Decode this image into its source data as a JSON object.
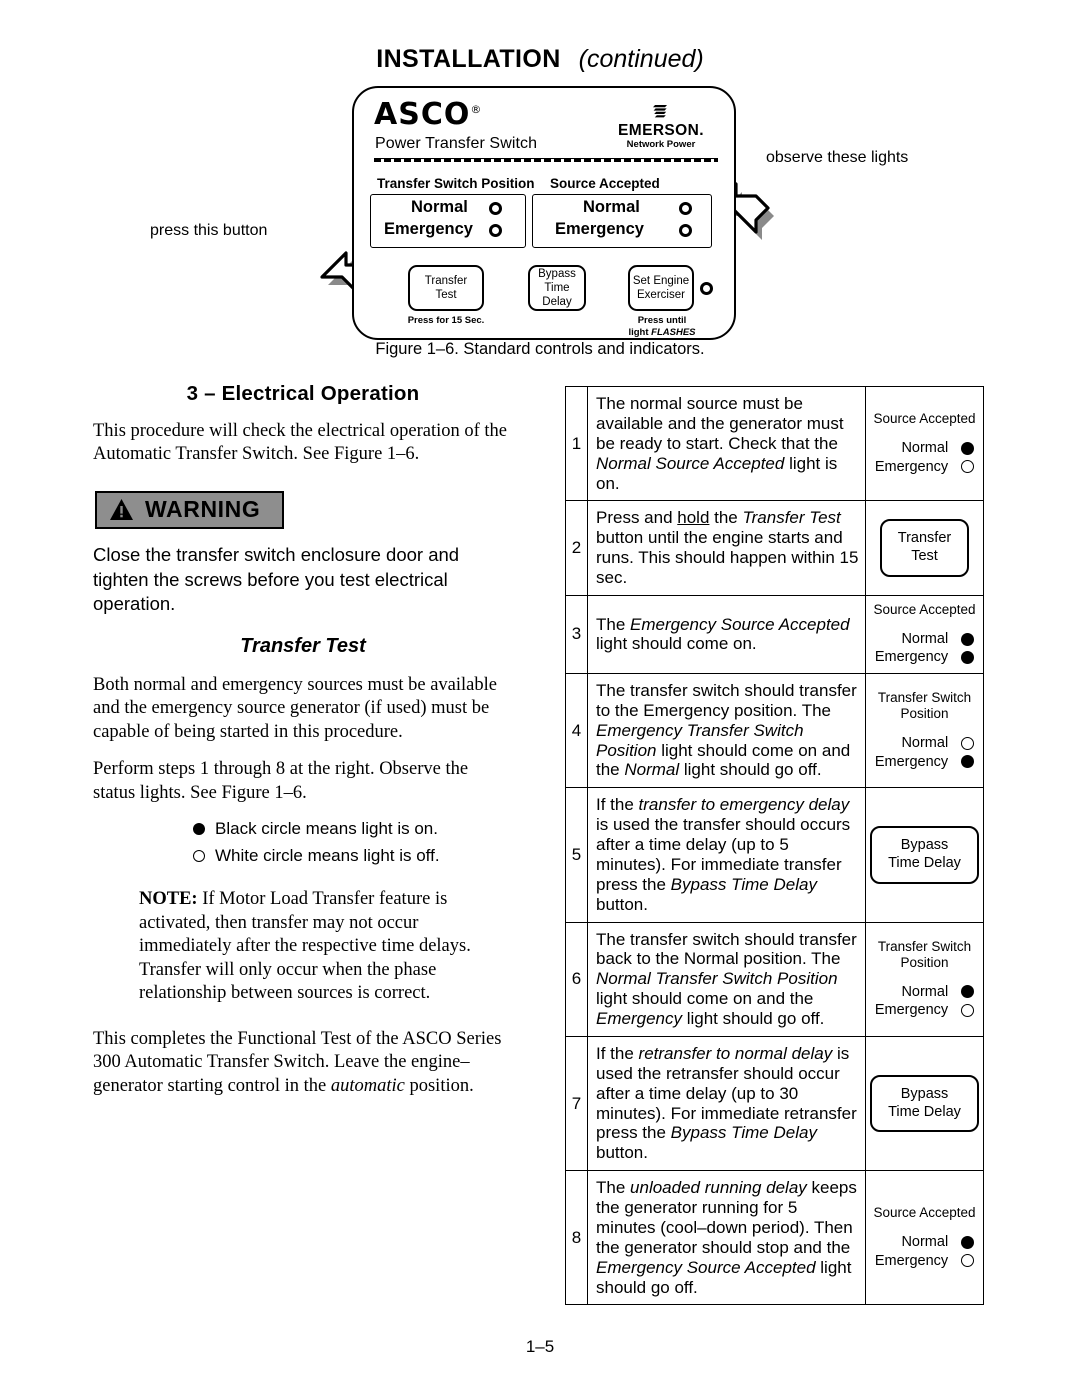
{
  "header": {
    "title": "INSTALLATION",
    "continued": "(continued)"
  },
  "figure": {
    "caption": "Figure 1–6.  Standard controls and indicators.",
    "callout_left": "press this button",
    "callout_right": "observe these lights",
    "panel": {
      "brand": "ASCO",
      "brand_mark": "®",
      "brand_sub": "Power Transfer Switch",
      "oem_name": "EMERSON.",
      "oem_sub": "Network Power",
      "group_left_label": "Transfer Switch Position",
      "group_right_label": "Source Accepted",
      "row_normal": "Normal",
      "row_emergency": "Emergency",
      "buttons": [
        {
          "line1": "Transfer",
          "line2": "Test",
          "note": "Press for 15 Sec.",
          "has_led": false
        },
        {
          "line1": "Bypass",
          "line2": "Time Delay",
          "note": "",
          "has_led": false
        },
        {
          "line1": "Set Engine",
          "line2": "Exerciser",
          "note_line1": "Press until",
          "note_line2a": "light ",
          "note_line2b": "FLASHES",
          "has_led": true
        }
      ]
    }
  },
  "left": {
    "section_heading": "3 – Electrical Operation",
    "intro": "This procedure will check the electrical operation of the Automatic Transfer Switch.  See Figure 1–6.",
    "warning_label": "WARNING",
    "warning_text": "Close the transfer switch enclosure door and tighten the screws before you test electrical operation.",
    "subheading": "Transfer Test",
    "para_sources": "Both normal and emergency sources must be available and the emergency source generator (if used) must be capable of being started in this procedure.",
    "para_perform": "Perform steps 1 through 8 at the right.  Observe the status lights.  See Figure 1–6.",
    "legend_on": "Black circle means light is on.",
    "legend_off": "White circle means light is off.",
    "note_label": "NOTE:",
    "note_text": "If Motor Load Transfer feature is activated, then transfer may not occur immediately after the respective time delays.  Transfer will only occur when the phase relationship between sources is correct.",
    "closing_a": "This completes the Functional Test of the ASCO Series 300 Automatic Transfer Switch.  Leave the engine–generator starting control in the ",
    "closing_italic": "automatic",
    "closing_b": " position."
  },
  "steps": [
    {
      "num": "1",
      "desc_parts": [
        {
          "t": "The normal source must be available and the generator must be ready to start. Check that the ",
          "s": "plain"
        },
        {
          "t": "Normal Source Accepted",
          "s": "italic"
        },
        {
          "t": " light is on.",
          "s": "plain"
        }
      ],
      "indicator": {
        "kind": "lights",
        "title": "Source Accepted",
        "normal": "Normal",
        "emergency": "Emergency",
        "normal_on": true,
        "emergency_on": false
      }
    },
    {
      "num": "2",
      "desc_parts": [
        {
          "t": "Press and ",
          "s": "plain"
        },
        {
          "t": "hold",
          "s": "underline"
        },
        {
          "t": " the ",
          "s": "plain"
        },
        {
          "t": "Transfer Test",
          "s": "italic"
        },
        {
          "t": " button until the engine starts and runs. This should happen within 15 sec.",
          "s": "plain"
        }
      ],
      "indicator": {
        "kind": "button",
        "line1": "Transfer",
        "line2": "Test"
      }
    },
    {
      "num": "3",
      "desc_parts": [
        {
          "t": "The ",
          "s": "plain"
        },
        {
          "t": "Emergency Source Accepted",
          "s": "italic"
        },
        {
          "t": " light should come on.",
          "s": "plain"
        }
      ],
      "indicator": {
        "kind": "lights",
        "title": "Source Accepted",
        "normal": "Normal",
        "emergency": "Emergency",
        "normal_on": true,
        "emergency_on": true
      }
    },
    {
      "num": "4",
      "desc_parts": [
        {
          "t": "The transfer switch should transfer to the Emergency position. The ",
          "s": "plain"
        },
        {
          "t": "Emergency Transfer Switch Position",
          "s": "italic"
        },
        {
          "t": " light should come on and the ",
          "s": "plain"
        },
        {
          "t": "Normal",
          "s": "italic"
        },
        {
          "t": " light should go off.",
          "s": "plain"
        }
      ],
      "indicator": {
        "kind": "lights",
        "title": "Transfer Switch Position",
        "normal": "Normal",
        "emergency": "Emergency",
        "normal_on": false,
        "emergency_on": true
      }
    },
    {
      "num": "5",
      "desc_parts": [
        {
          "t": "If the ",
          "s": "plain"
        },
        {
          "t": "transfer to emergency delay",
          "s": "italic"
        },
        {
          "t": " is used the transfer should occurs after a time delay (up to 5 minutes). For immediate transfer press the ",
          "s": "plain"
        },
        {
          "t": "Bypass Time Delay",
          "s": "italic"
        },
        {
          "t": " button.",
          "s": "plain"
        }
      ],
      "indicator": {
        "kind": "button",
        "line1": "Bypass",
        "line2": "Time Delay"
      }
    },
    {
      "num": "6",
      "desc_parts": [
        {
          "t": "The transfer switch should transfer back to the Normal position. The ",
          "s": "plain"
        },
        {
          "t": "Normal Transfer Switch Position",
          "s": "italic"
        },
        {
          "t": " light should come on and the ",
          "s": "plain"
        },
        {
          "t": "Emergency",
          "s": "italic"
        },
        {
          "t": " light should go off.",
          "s": "plain"
        }
      ],
      "indicator": {
        "kind": "lights",
        "title": "Transfer Switch Position",
        "normal": "Normal",
        "emergency": "Emergency",
        "normal_on": true,
        "emergency_on": false
      }
    },
    {
      "num": "7",
      "desc_parts": [
        {
          "t": "If the ",
          "s": "plain"
        },
        {
          "t": "retransfer to normal delay",
          "s": "italic"
        },
        {
          "t": " is used the retransfer should occur after a time delay (up to 30 minutes). For immediate retransfer press the ",
          "s": "plain"
        },
        {
          "t": "Bypass Time Delay",
          "s": "italic"
        },
        {
          "t": " button.",
          "s": "plain"
        }
      ],
      "indicator": {
        "kind": "button",
        "line1": "Bypass",
        "line2": "Time Delay"
      }
    },
    {
      "num": "8",
      "desc_parts": [
        {
          "t": "The ",
          "s": "plain"
        },
        {
          "t": "unloaded running delay",
          "s": "italic"
        },
        {
          "t": " keeps the generator running for 5 minutes (cool–down period). Then the generator should stop and the ",
          "s": "plain"
        },
        {
          "t": "Emergency Source Accepted",
          "s": "italic"
        },
        {
          "t": " light should go off.",
          "s": "plain"
        }
      ],
      "indicator": {
        "kind": "lights",
        "title": "Source Accepted",
        "normal": "Normal",
        "emergency": "Emergency",
        "normal_on": true,
        "emergency_on": false
      }
    }
  ],
  "page_number": "1–5"
}
